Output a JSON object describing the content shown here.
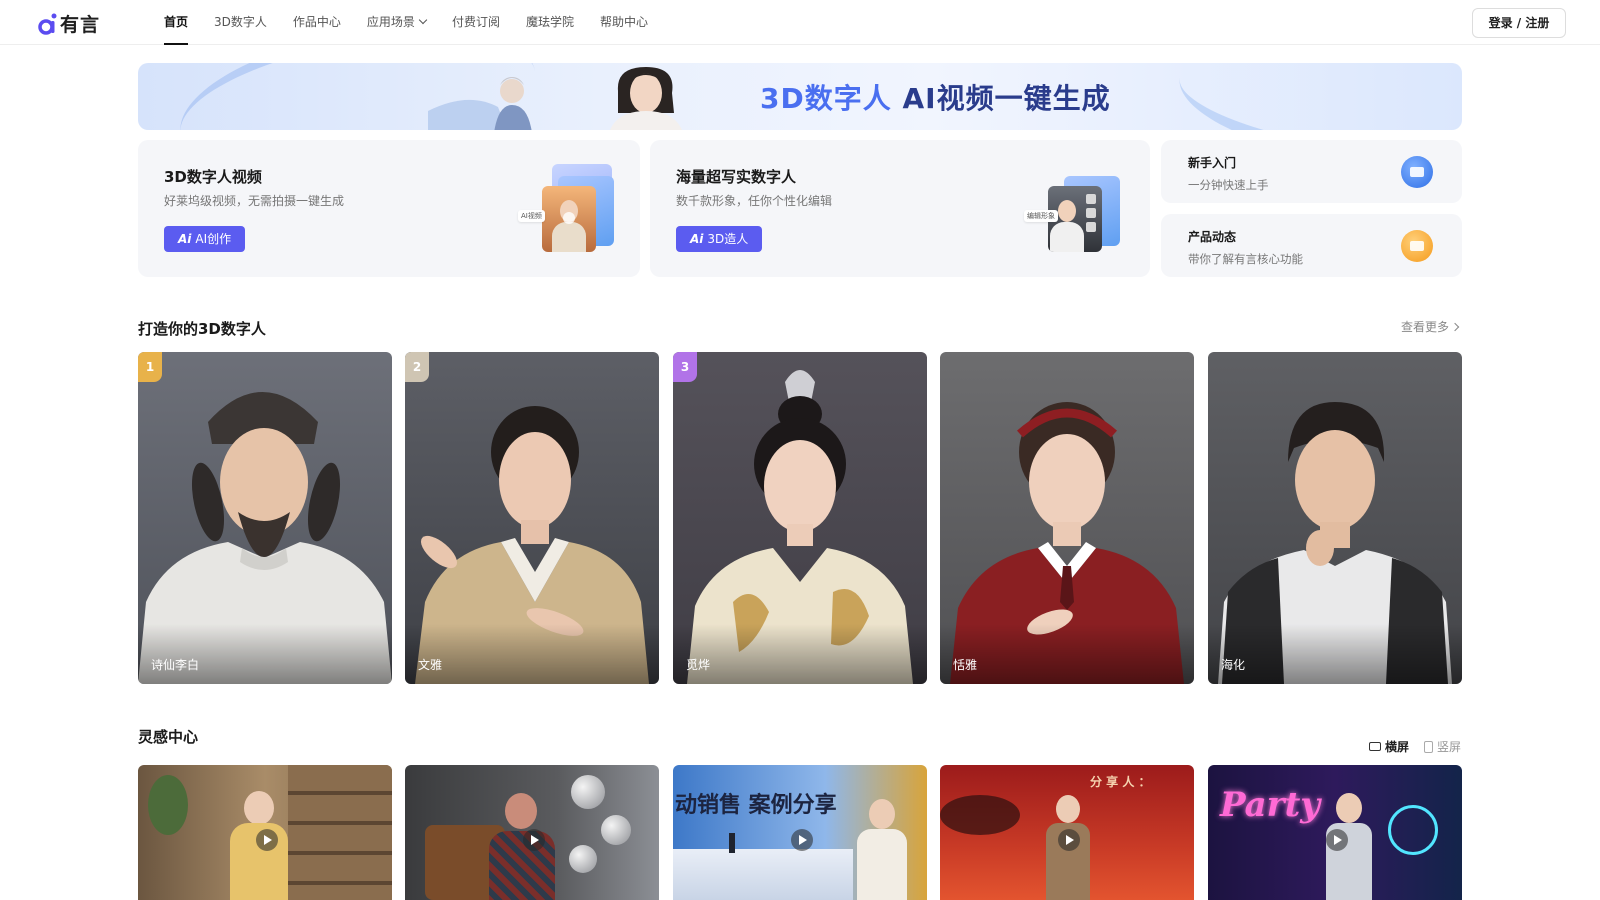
{
  "brand": {
    "name": "有言"
  },
  "nav": {
    "items": [
      {
        "label": "首页",
        "active": true
      },
      {
        "label": "3D数字人"
      },
      {
        "label": "作品中心"
      },
      {
        "label": "应用场景",
        "dropdown": true
      },
      {
        "label": "付费订阅"
      },
      {
        "label": "魔珐学院"
      },
      {
        "label": "帮助中心"
      }
    ],
    "login_label": "登录 / 注册"
  },
  "banner": {
    "title_accent": "3D数字人",
    "title_rest": " AI视频一键生成"
  },
  "features": [
    {
      "title": "3D数字人视频",
      "desc": "好莱坞级视频，无需拍摄一键生成",
      "cta_prefix": "Ai",
      "cta": "AI创作",
      "illus_tag": "AI视频"
    },
    {
      "title": "海量超写实数字人",
      "desc": "数千款形象，任你个性化编辑",
      "cta_prefix": "Ai",
      "cta": "3D造人",
      "illus_tag": "编辑形象"
    }
  ],
  "side_cards": [
    {
      "title": "新手入门",
      "desc": "一分钟快速上手",
      "icon": "graduation-cap-icon",
      "color": "#2f6fe6"
    },
    {
      "title": "产品动态",
      "desc": "带你了解有言核心功能",
      "icon": "gift-box-icon",
      "color": "#f59a1c"
    }
  ],
  "avatars_section": {
    "title": "打造你的3D数字人",
    "more_label": "查看更多",
    "items": [
      {
        "rank": "1",
        "name": "诗仙李白"
      },
      {
        "rank": "2",
        "name": "文雅"
      },
      {
        "rank": "3",
        "name": "觅烨"
      },
      {
        "rank": "",
        "name": "恬雅"
      },
      {
        "rank": "",
        "name": "海化"
      }
    ]
  },
  "inspiration_section": {
    "title": "灵感中心",
    "landscape_label": "横屏",
    "portrait_label": "竖屏",
    "items": [
      {
        "overlay": ""
      },
      {
        "overlay": ""
      },
      {
        "overlay": "动销售 案例分享"
      },
      {
        "overlay": "分 享 人 ："
      },
      {
        "overlay": "Party"
      }
    ]
  },
  "colors": {
    "primary": "#5b5cf0",
    "accent_blue": "#4a6ff0",
    "rank_gold": "#e8b24a",
    "rank_purple": "#b173e8"
  }
}
